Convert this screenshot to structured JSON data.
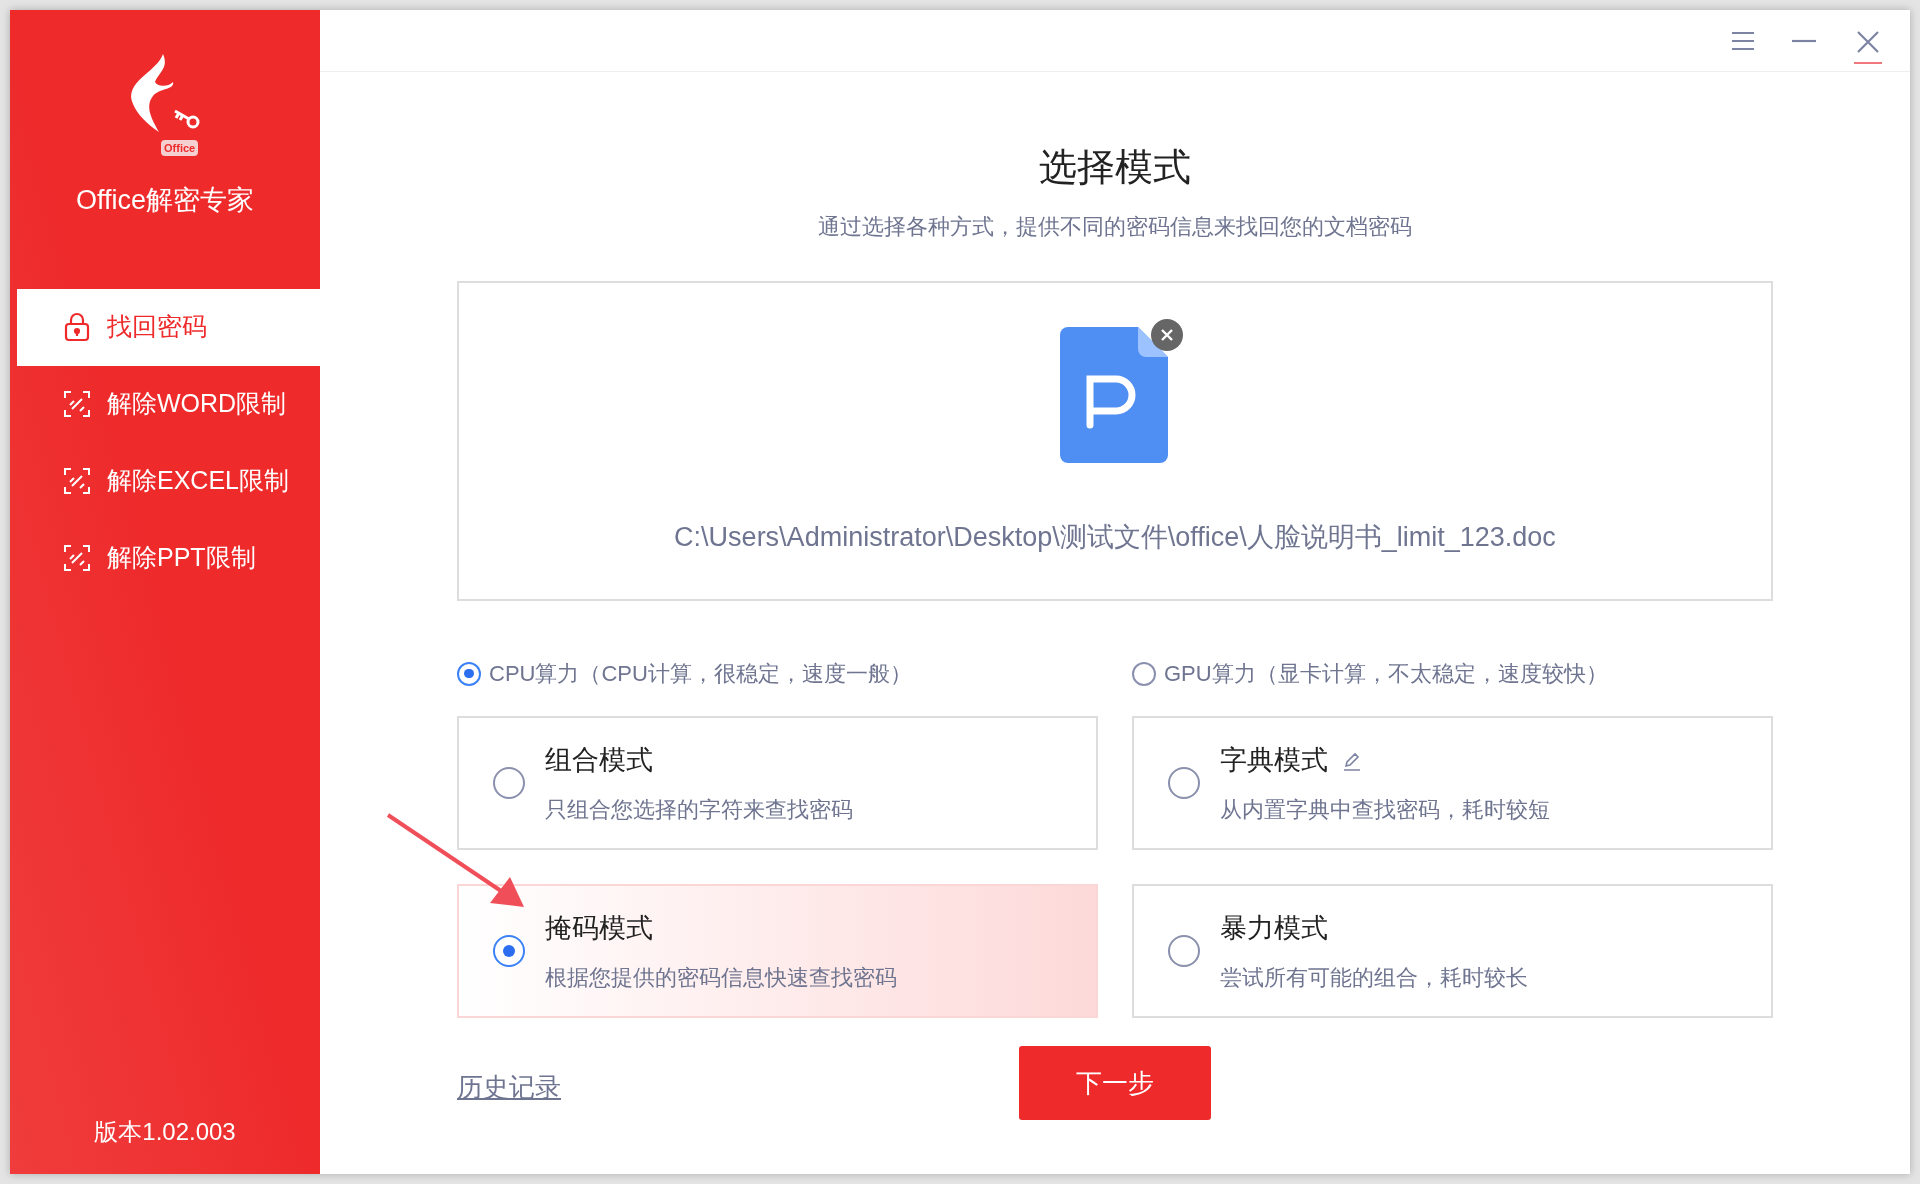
{
  "app": {
    "logo_badge": "Office",
    "name": "Office解密专家",
    "version": "版本1.02.003"
  },
  "sidebar": {
    "items": [
      {
        "label": "找回密码",
        "selected": true,
        "kind": "lock"
      },
      {
        "label": "解除WORD限制",
        "selected": false,
        "kind": "unlink"
      },
      {
        "label": "解除EXCEL限制",
        "selected": false,
        "kind": "unlink"
      },
      {
        "label": "解除PPT限制",
        "selected": false,
        "kind": "unlink"
      }
    ]
  },
  "page": {
    "title": "选择模式",
    "subtitle": "通过选择各种方式，提供不同的密码信息来找回您的文档密码"
  },
  "file": {
    "path": "C:\\Users\\Administrator\\Desktop\\测试文件\\office\\人脸说明书_limit_123.doc"
  },
  "compute": [
    {
      "label": "CPU算力（CPU计算，很稳定，速度一般）",
      "selected": true
    },
    {
      "label": "GPU算力（显卡计算，不太稳定，速度较快）",
      "selected": false
    }
  ],
  "modes": [
    {
      "title": "组合模式",
      "description": "只组合您选择的字符来查找密码",
      "selected": false,
      "editable": false
    },
    {
      "title": "字典模式",
      "description": "从内置字典中查找密码，耗时较短",
      "selected": false,
      "editable": true
    },
    {
      "title": "掩码模式",
      "description": "根据您提供的密码信息快速查找密码",
      "selected": true,
      "editable": false
    },
    {
      "title": "暴力模式",
      "description": "尝试所有可能的组合，耗时较长",
      "selected": false,
      "editable": false
    }
  ],
  "history_link": "历史记录",
  "next_button": "下一步"
}
